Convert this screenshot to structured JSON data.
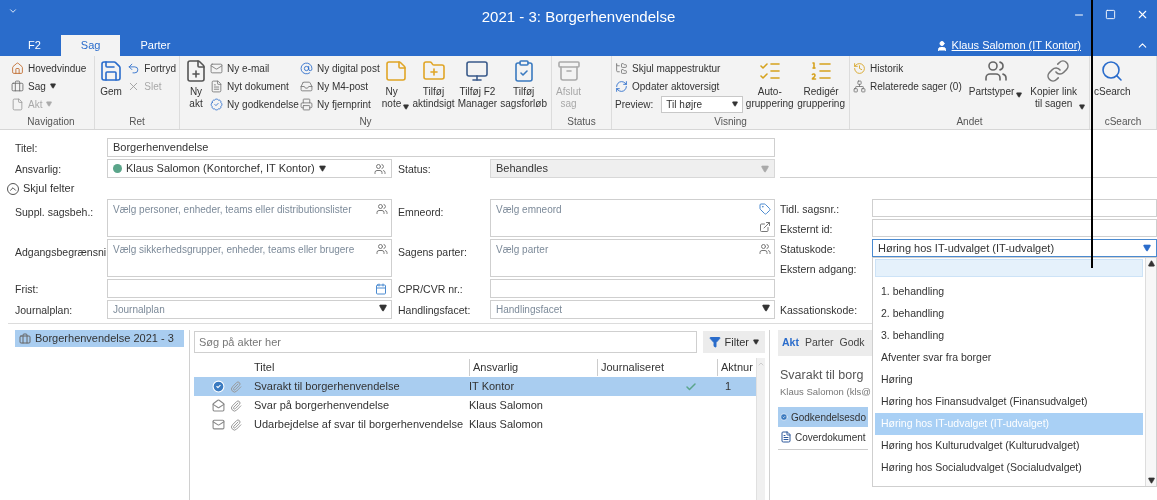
{
  "window": {
    "title": "2021 - 3: Borgerhenvendelse"
  },
  "ribbon_tabs": [
    {
      "label": "F2",
      "selected": false
    },
    {
      "label": "Sag",
      "selected": true
    },
    {
      "label": "Parter",
      "selected": false
    }
  ],
  "user": {
    "name": "Klaus Salomon (IT Kontor)"
  },
  "ribbon_groups": [
    {
      "label": "Navigation",
      "columns": [
        {
          "kind": "stack",
          "items": [
            {
              "kind": "button",
              "label": "Hovedvindue",
              "disabled": false,
              "menu": false
            },
            {
              "kind": "button",
              "label": "Sag",
              "disabled": false,
              "menu": true
            },
            {
              "kind": "button",
              "label": "Akt",
              "disabled": true,
              "menu": true
            }
          ]
        }
      ]
    },
    {
      "label": "Ret",
      "columns": [
        {
          "kind": "large",
          "label": "Gem",
          "disabled": false,
          "menu": false
        },
        {
          "kind": "stack",
          "items": [
            {
              "kind": "button",
              "label": "Fortryd",
              "disabled": false,
              "menu": false
            },
            {
              "kind": "button",
              "label": "Slet",
              "disabled": true,
              "menu": false
            }
          ]
        }
      ]
    },
    {
      "label": "Ny",
      "columns": [
        {
          "kind": "large",
          "label": "Ny\nakt",
          "disabled": false,
          "menu": false
        },
        {
          "kind": "stack",
          "items": [
            {
              "kind": "button",
              "label": "Ny e-mail",
              "disabled": false,
              "menu": false
            },
            {
              "kind": "button",
              "label": "Nyt dokument",
              "disabled": false,
              "menu": false
            },
            {
              "kind": "button",
              "label": "Ny godkendelse",
              "disabled": false,
              "menu": false
            }
          ]
        },
        {
          "kind": "stack",
          "items": [
            {
              "kind": "button",
              "label": "Ny digital post",
              "disabled": false,
              "menu": false
            },
            {
              "kind": "button",
              "label": "Ny M4-post",
              "disabled": false,
              "menu": false
            },
            {
              "kind": "button",
              "label": "Ny fjernprint",
              "disabled": false,
              "menu": false
            }
          ]
        },
        {
          "kind": "large",
          "label": "Ny\nnote",
          "disabled": false,
          "menu": true
        },
        {
          "kind": "large",
          "label": "Tilføj\naktindsigt",
          "disabled": false,
          "menu": false
        },
        {
          "kind": "large",
          "label": "Tilføj F2\nManager",
          "disabled": false,
          "menu": false
        },
        {
          "kind": "large",
          "label": "Tilføj\nsagsforløb",
          "disabled": false,
          "menu": false
        }
      ]
    },
    {
      "label": "Status",
      "columns": [
        {
          "kind": "large",
          "label": "Afslut\nsag",
          "disabled": true,
          "menu": false
        }
      ]
    },
    {
      "label": "Visning",
      "columns": [
        {
          "kind": "stack",
          "items": [
            {
              "kind": "button",
              "label": "Skjul mappestruktur",
              "disabled": false,
              "menu": false
            },
            {
              "kind": "button",
              "label": "Opdater aktoversigt",
              "disabled": false,
              "menu": false
            },
            {
              "kind": "select",
              "label": "Preview:",
              "value": "Til højre"
            }
          ]
        },
        {
          "kind": "large",
          "label": "Auto-\ngruppering",
          "disabled": false,
          "menu": false
        },
        {
          "kind": "large",
          "label": "Redigér\ngruppering",
          "disabled": false,
          "menu": false
        }
      ]
    },
    {
      "label": "Andet",
      "columns": [
        {
          "kind": "stack",
          "items": [
            {
              "kind": "button",
              "label": "Historik",
              "disabled": false,
              "menu": false
            },
            {
              "kind": "button",
              "label": "Relaterede sager (0)",
              "disabled": false,
              "menu": false
            }
          ]
        },
        {
          "kind": "large",
          "label": "Partstyper",
          "disabled": false,
          "menu": true
        },
        {
          "kind": "large",
          "label": "Kopier link\ntil sagen",
          "disabled": false,
          "menu": true
        }
      ]
    },
    {
      "label": "cSearch",
      "columns": [
        {
          "kind": "large",
          "label": "cSearch",
          "disabled": false,
          "menu": false
        }
      ]
    }
  ],
  "form": {
    "title": {
      "label": "Titel:",
      "value": "Borgerhenvendelse"
    },
    "responsible": {
      "label": "Ansvarlig:",
      "value": "Klaus Salomon (Kontorchef, IT Kontor)"
    },
    "status": {
      "label": "Status:",
      "value": "Behandles",
      "disabled": true
    },
    "toggle": {
      "label": "Skjul felter",
      "expanded": true
    },
    "co_caseworkers": {
      "label": "Suppl. sagsbeh.:",
      "placeholder": "Vælg personer, enheder, teams eller distributionslister"
    },
    "keywords": {
      "label": "Emneord:",
      "placeholder": "Vælg emneord"
    },
    "access": {
      "label": "Adgangsbegrænsni",
      "placeholder": "Vælg sikkerhedsgrupper, enheder, teams eller brugere"
    },
    "parties": {
      "label": "Sagens parter:",
      "placeholder": "Vælg parter"
    },
    "deadline": {
      "label": "Frist:"
    },
    "cpr": {
      "label": "CPR/CVR nr.:"
    },
    "journal_plan": {
      "label": "Journalplan:",
      "placeholder": "Journalplan"
    },
    "action_facet": {
      "label": "Handlingsfacet:",
      "placeholder": "Handlingsfacet"
    },
    "previous_case_no": {
      "label": "Tidl. sagsnr.:"
    },
    "external_id": {
      "label": "Eksternt id:"
    },
    "status_code": {
      "label": "Statuskode:",
      "value": "Høring hos IT-udvalget (IT-udvalget)",
      "expanded": true
    },
    "external_access": {
      "label": "Ekstern adgang:"
    },
    "retention_code": {
      "label": "Kassationskode:"
    }
  },
  "status_code_options": [
    {
      "label": "1. behandling",
      "selected": false
    },
    {
      "label": "2. behandling",
      "selected": false
    },
    {
      "label": "3. behandling",
      "selected": false
    },
    {
      "label": "Afventer svar fra borger",
      "selected": false
    },
    {
      "label": "Høring",
      "selected": false
    },
    {
      "label": "Høring hos Finansudvalget (Finansudvalget)",
      "selected": false
    },
    {
      "label": "Høring hos IT-udvalget (IT-udvalget)",
      "selected": true
    },
    {
      "label": "Høring hos Kulturudvalget (Kulturudvalget)",
      "selected": false
    },
    {
      "label": "Høring hos Socialudvalget (Socialudvalget)",
      "selected": false
    }
  ],
  "tree": [
    {
      "label": "Borgerhenvendelse 2021 - 3",
      "selected": true
    }
  ],
  "documents": {
    "search_placeholder": "Søg på akter her",
    "filter": "Filter",
    "columns": [
      "Titel",
      "Ansvarlig",
      "Journaliseret",
      "Aktnur"
    ],
    "rows": [
      {
        "kind": "approval",
        "title": "Svarakt til borgerhenvendelse",
        "responsible": "IT Kontor",
        "journalized": true,
        "number": "1",
        "selected": true
      },
      {
        "kind": "reply",
        "title": "Svar på borgerhenvendelse",
        "responsible": "Klaus Salomon",
        "journalized": false,
        "selected": false
      },
      {
        "kind": "mail",
        "title": "Udarbejdelse af svar til borgerhenvendelse",
        "responsible": "Klaus Salomon",
        "journalized": false,
        "selected": false
      }
    ]
  },
  "preview": {
    "tabs": [
      {
        "label": "Akt",
        "selected": true
      },
      {
        "label": "Parter",
        "selected": false
      },
      {
        "label": "Godk",
        "selected": false
      }
    ],
    "title": "Svarakt til borg",
    "subtitle": "Klaus Salomon (kls@",
    "attachments": [
      {
        "kind": "approval",
        "name": "Godkendelsesdo",
        "selected": true
      },
      {
        "kind": "word",
        "name": "Coverdokument",
        "selected": false
      }
    ]
  }
}
